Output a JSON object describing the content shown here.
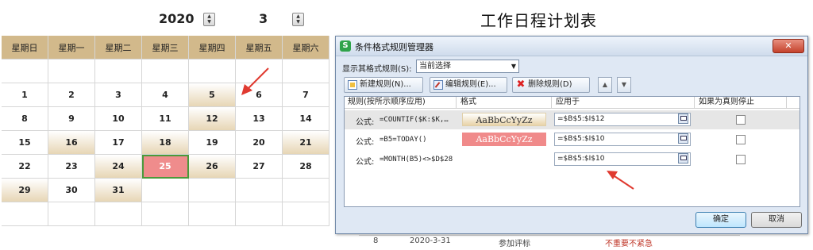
{
  "calendar": {
    "year": "2020",
    "month": "3",
    "spin_up": "▲",
    "spin_down": "▼",
    "title": "工作日程计划表",
    "weekdays": [
      "星期日",
      "星期一",
      "星期二",
      "星期三",
      "星期四",
      "星期五",
      "星期六"
    ],
    "weeks": [
      [
        {
          "d": "",
          "s": ""
        },
        {
          "d": "",
          "s": ""
        },
        {
          "d": "",
          "s": ""
        },
        {
          "d": "",
          "s": ""
        },
        {
          "d": "",
          "s": ""
        },
        {
          "d": "",
          "s": ""
        },
        {
          "d": "",
          "s": ""
        }
      ],
      [
        {
          "d": "1",
          "s": ""
        },
        {
          "d": "2",
          "s": ""
        },
        {
          "d": "3",
          "s": ""
        },
        {
          "d": "4",
          "s": ""
        },
        {
          "d": "5",
          "s": "tan"
        },
        {
          "d": "6",
          "s": ""
        },
        {
          "d": "7",
          "s": ""
        }
      ],
      [
        {
          "d": "8",
          "s": ""
        },
        {
          "d": "9",
          "s": ""
        },
        {
          "d": "10",
          "s": ""
        },
        {
          "d": "11",
          "s": ""
        },
        {
          "d": "12",
          "s": "tan"
        },
        {
          "d": "13",
          "s": ""
        },
        {
          "d": "14",
          "s": ""
        }
      ],
      [
        {
          "d": "15",
          "s": ""
        },
        {
          "d": "16",
          "s": "tan"
        },
        {
          "d": "17",
          "s": ""
        },
        {
          "d": "18",
          "s": "tan"
        },
        {
          "d": "19",
          "s": ""
        },
        {
          "d": "20",
          "s": ""
        },
        {
          "d": "21",
          "s": "tan"
        }
      ],
      [
        {
          "d": "22",
          "s": ""
        },
        {
          "d": "23",
          "s": ""
        },
        {
          "d": "24",
          "s": "tan"
        },
        {
          "d": "25",
          "s": "pink"
        },
        {
          "d": "26",
          "s": "tan"
        },
        {
          "d": "27",
          "s": ""
        },
        {
          "d": "28",
          "s": ""
        }
      ],
      [
        {
          "d": "29",
          "s": "tan"
        },
        {
          "d": "30",
          "s": ""
        },
        {
          "d": "31",
          "s": "tan"
        },
        {
          "d": "",
          "s": ""
        },
        {
          "d": "",
          "s": ""
        },
        {
          "d": "",
          "s": ""
        },
        {
          "d": "",
          "s": ""
        }
      ],
      [
        {
          "d": "",
          "s": ""
        },
        {
          "d": "",
          "s": ""
        },
        {
          "d": "",
          "s": ""
        },
        {
          "d": "",
          "s": ""
        },
        {
          "d": "",
          "s": ""
        },
        {
          "d": "",
          "s": ""
        },
        {
          "d": "",
          "s": ""
        }
      ]
    ]
  },
  "sheet_row": {
    "num": "8",
    "date": "2020-3-31",
    "task": "参加评标",
    "priority": "不重要不紧急"
  },
  "dialog": {
    "app_icon": "S",
    "title": "条件格式规则管理器",
    "close": "✕",
    "show_label": "显示其格式规则(S):",
    "show_value": "当前选择",
    "buttons": {
      "new": "新建规则(N)...",
      "edit": "编辑规则(E)...",
      "delete": "删除规则(D)",
      "delete_icon": "✖",
      "up": "▲",
      "down": "▼"
    },
    "columns": {
      "rule": "规则(按所示顺序应用)",
      "format": "格式",
      "applies": "应用于",
      "stop": "如果为真则停止"
    },
    "rules": [
      {
        "label": "公式:",
        "formula": "=COUNTIF($K:$K,…",
        "preview": "AaBbCcYyZz",
        "applies": "=$B$5:$I$12"
      },
      {
        "label": "公式:",
        "formula": "=B5=TODAY()",
        "preview": "AaBbCcYyZz",
        "applies": "=$B$5:$I$10"
      },
      {
        "label": "公式:",
        "formula": "=MONTH(B5)<>$D$28",
        "preview": "",
        "applies": "=$B$5:$I$10"
      }
    ],
    "ok": "确定",
    "cancel": "取消"
  },
  "colors": {
    "header_bg": "#d2b98b",
    "highlight_tan": "#e7d6b5",
    "today_pink": "#ef8c8c",
    "arrow_red": "#e03a30"
  }
}
